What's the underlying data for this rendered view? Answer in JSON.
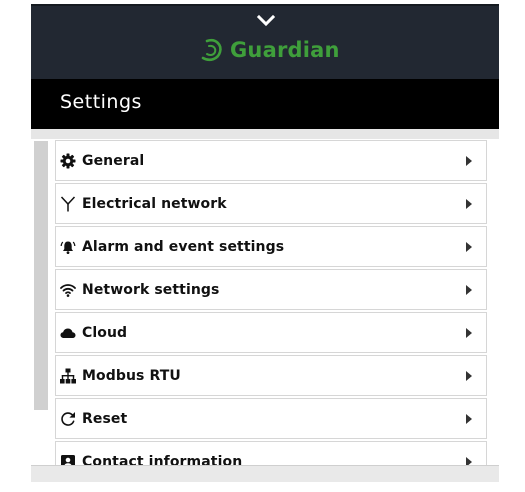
{
  "header": {
    "brand_name": "Guardian",
    "brand_color": "#3f9f3b",
    "collapse_icon": "chevron-down-icon"
  },
  "page": {
    "title": "Settings"
  },
  "menu": {
    "items": [
      {
        "label": "General",
        "icon": "gear-icon"
      },
      {
        "label": "Electrical network",
        "icon": "network-branch-icon"
      },
      {
        "label": "Alarm and event settings",
        "icon": "alarm-bell-icon"
      },
      {
        "label": "Network settings",
        "icon": "wifi-icon"
      },
      {
        "label": "Cloud",
        "icon": "cloud-icon"
      },
      {
        "label": "Modbus RTU",
        "icon": "hierarchy-icon"
      },
      {
        "label": "Reset",
        "icon": "reset-icon"
      },
      {
        "label": "Contact information",
        "icon": "contact-icon"
      }
    ],
    "arrow_icon": "caret-right-icon"
  }
}
